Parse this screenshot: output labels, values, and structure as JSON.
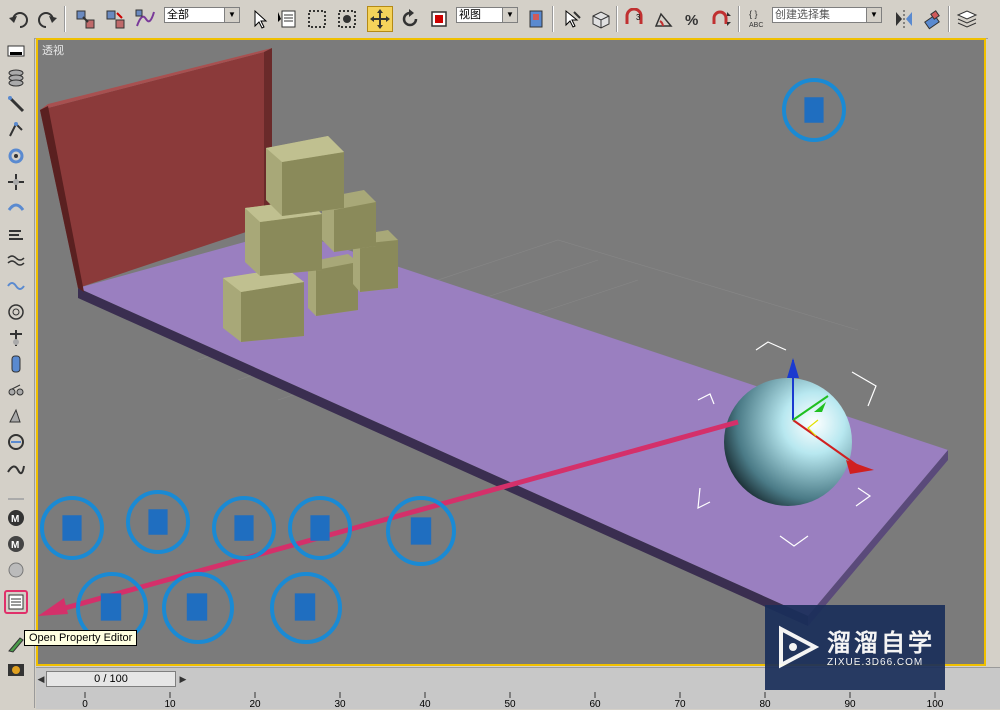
{
  "toolbar": {
    "selection_filter": "全部",
    "reference_coord": "视图",
    "named_selection": "创建选择集",
    "icons": [
      "undo-icon",
      "redo-icon",
      "select-link-icon",
      "unlink-icon",
      "bind-spacewarp-icon",
      "select-object-icon",
      "select-by-name-icon",
      "rect-region-icon",
      "window-crossing-icon",
      "move-icon",
      "rotate-icon",
      "scale-icon",
      "pivot-center-icon",
      "select-manipulate-icon",
      "keyboard-shortcut-icon",
      "snap-3d-icon",
      "angle-snap-icon",
      "percent-snap-icon",
      "spinner-snap-icon",
      "edit-named-selection-icon",
      "mirror-icon",
      "align-icon",
      "layer-manager-icon"
    ]
  },
  "left_toolbar": {
    "icons": [
      "display-icon",
      "layers-icon",
      "spacewarp-icon",
      "modifier-icon",
      "hierarchy-icon",
      "gear-icon",
      "helper-icon",
      "wind-icon",
      "bend-icon",
      "wave-icon",
      "ripple-icon",
      "path-icon",
      "joint-icon",
      "camera-icon",
      "skin-icon",
      "link-icon",
      "spline-icon",
      "fill-icon",
      "max-m-icon",
      "max-m2-icon",
      "sphere-icon",
      "property-editor-icon",
      "brush-icon",
      "render-icon"
    ],
    "highlighted": "property-editor-icon"
  },
  "viewport": {
    "label": "透视"
  },
  "tooltip": {
    "text": "Open Property Editor"
  },
  "timeline": {
    "frame_display": "0 / 100",
    "tick_labels": [
      "0",
      "10",
      "20",
      "30",
      "40",
      "50",
      "60",
      "70",
      "80",
      "90",
      "100"
    ]
  },
  "watermark": {
    "title": "溜溜自学",
    "subtitle": "ZIXUE.3D66.COM"
  },
  "colors": {
    "viewport_bg": "#7b7b7b",
    "viewport_border": "#f0c000",
    "wall": "#8b3a3a",
    "floor": "#9a7fc0",
    "boxes": "#a8a878",
    "sphere": "#b8e8f0",
    "circle_highlight": "#1a8ad4",
    "arrow": "#d4306a",
    "active_button": "#f5d35b"
  }
}
